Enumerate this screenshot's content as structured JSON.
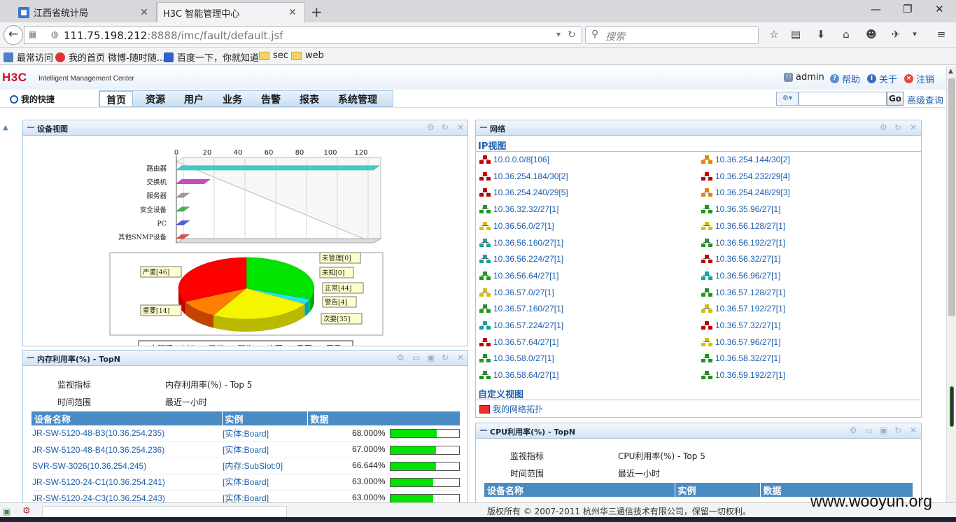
{
  "browser": {
    "tabs": [
      {
        "title": "江西省统计局",
        "close": "✕"
      },
      {
        "title": "H3C 智能管理中心",
        "close": "✕"
      }
    ],
    "new_tab": "+",
    "window_controls": {
      "minimize": "—",
      "maximize": "❐",
      "close": "✕"
    },
    "url_host": "111.75.198.212",
    "url_rest": ":8888/imc/fault/default.jsf",
    "search_placeholder": "搜索",
    "bookmarks": [
      "最常访问",
      "我的首页 微博-随时随...",
      "百度一下，你就知道",
      "sec",
      "web"
    ]
  },
  "imc": {
    "logo": "H3C",
    "logo_subtitle": "Intelligent Management Center",
    "user": "admin",
    "help": "帮助",
    "about": "关于",
    "logout": "注销",
    "quick_label": "我的快捷",
    "menus": [
      "首页",
      "资源",
      "用户",
      "业务",
      "告警",
      "报表",
      "系统管理"
    ],
    "selected_menu": "首页",
    "go_label": "Go",
    "advanced_query": "高级查询"
  },
  "device_view": {
    "title": "设备视图",
    "chart_data": [
      {
        "type": "bar",
        "orientation": "horizontal",
        "categories": [
          "路由器",
          "交换机",
          "服务器",
          "安全设备",
          "PC",
          "其他SNMP设备"
        ],
        "values": [
          128,
          18,
          0,
          0,
          0,
          0
        ],
        "xlim": [
          0,
          130
        ],
        "xticks": [
          "0",
          "20",
          "40",
          "60",
          "80",
          "100",
          "120"
        ],
        "colors": [
          "#46c8c4",
          "#c34fc0",
          "#9a9a9a",
          "#4caf50",
          "#5560d0",
          "#d05555"
        ]
      },
      {
        "type": "pie",
        "slices": [
          {
            "label": "未管理[0]",
            "name": "未管理",
            "value": 0,
            "color": "#808080"
          },
          {
            "label": "未知[0]",
            "name": "未知",
            "value": 0,
            "color": "#0000dd"
          },
          {
            "label": "正常[44]",
            "name": "正常",
            "value": 44,
            "color": "#00e400"
          },
          {
            "label": "警告[4]",
            "name": "警告",
            "value": 4,
            "color": "#22e6e6"
          },
          {
            "label": "次要[35]",
            "name": "次要",
            "value": 35,
            "color": "#f5f500"
          },
          {
            "label": "重要[14]",
            "name": "重要",
            "value": 14,
            "color": "#ff8000"
          },
          {
            "label": "严重[46]",
            "name": "严重",
            "value": 46,
            "color": "#ff0000"
          }
        ]
      }
    ]
  },
  "network": {
    "title": "网络",
    "ip_view": "IP视图",
    "custom_view": "自定义视图",
    "custom_item": "我的网络拓扑",
    "left": [
      {
        "label": "10.0.0.0/8[106]",
        "color": "#c00000"
      },
      {
        "label": "10.36.254.184/30[2]",
        "color": "#c00000"
      },
      {
        "label": "10.36.254.240/29[5]",
        "color": "#c00000"
      },
      {
        "label": "10.36.32.32/27[1]",
        "color": "#1a9a1a"
      },
      {
        "label": "10.36.56.0/27[1]",
        "color": "#d6c000"
      },
      {
        "label": "10.36.56.160/27[1]",
        "color": "#1aa0a0"
      },
      {
        "label": "10.36.56.224/27[1]",
        "color": "#1aa0a0"
      },
      {
        "label": "10.36.56.64/27[1]",
        "color": "#1a9a1a"
      },
      {
        "label": "10.36.57.0/27[1]",
        "color": "#d6c000"
      },
      {
        "label": "10.36.57.160/27[1]",
        "color": "#1a9a1a"
      },
      {
        "label": "10.36.57.224/27[1]",
        "color": "#1aa0a0"
      },
      {
        "label": "10.36.57.64/27[1]",
        "color": "#c00000"
      },
      {
        "label": "10.36.58.0/27[1]",
        "color": "#1a9a1a"
      },
      {
        "label": "10.36.58.64/27[1]",
        "color": "#1a9a1a"
      }
    ],
    "right": [
      {
        "label": "10.36.254.144/30[2]",
        "color": "#d98a00"
      },
      {
        "label": "10.36.254.232/29[4]",
        "color": "#c00000"
      },
      {
        "label": "10.36.254.248/29[3]",
        "color": "#d98a00"
      },
      {
        "label": "10.36.35.96/27[1]",
        "color": "#1a9a1a"
      },
      {
        "label": "10.36.56.128/27[1]",
        "color": "#d6c000"
      },
      {
        "label": "10.36.56.192/27[1]",
        "color": "#1a9a1a"
      },
      {
        "label": "10.36.56.32/27[1]",
        "color": "#c00000"
      },
      {
        "label": "10.36.56.96/27[1]",
        "color": "#1aa0a0"
      },
      {
        "label": "10.36.57.128/27[1]",
        "color": "#1a9a1a"
      },
      {
        "label": "10.36.57.192/27[1]",
        "color": "#d6c000"
      },
      {
        "label": "10.36.57.32/27[1]",
        "color": "#c00000"
      },
      {
        "label": "10.36.57.96/27[1]",
        "color": "#d6c000"
      },
      {
        "label": "10.36.58.32/27[1]",
        "color": "#1a9a1a"
      },
      {
        "label": "10.36.59.192/27[1]",
        "color": "#1a9a1a"
      }
    ]
  },
  "memory": {
    "title": "内存利用率(%) - TopN",
    "meta": [
      {
        "k": "监视指标",
        "v": "内存利用率(%) - Top 5"
      },
      {
        "k": "时间范围",
        "v": "最近一小时"
      }
    ],
    "headers": [
      "设备名称",
      "实例",
      "数据"
    ],
    "rows": [
      {
        "device": "JR-SW-5120-48-B3(10.36.254.235)",
        "instance": "[实体:Board]",
        "value": "68.000%",
        "pct": 68
      },
      {
        "device": "JR-SW-5120-48-B4(10.36.254.236)",
        "instance": "[实体:Board]",
        "value": "67.000%",
        "pct": 67
      },
      {
        "device": "SVR-SW-3026(10.36.254.245)",
        "instance": "[内存:SubSlot:0]",
        "value": "66.644%",
        "pct": 66.644
      },
      {
        "device": "JR-SW-5120-24-C1(10.36.254.241)",
        "instance": "[实体:Board]",
        "value": "63.000%",
        "pct": 63
      },
      {
        "device": "JR-SW-5120-24-C3(10.36.254.243)",
        "instance": "[实体:Board]",
        "value": "63.000%",
        "pct": 63
      }
    ]
  },
  "cpu": {
    "title": "CPU利用率(%) - TopN",
    "meta": [
      {
        "k": "监视指标",
        "v": "CPU利用率(%) - Top 5"
      },
      {
        "k": "时间范围",
        "v": "最近一小时"
      }
    ],
    "headers": [
      "设备名称",
      "实例",
      "数据"
    ]
  },
  "footer": {
    "copyright": "版权所有 © 2007-2011 杭州华三通信技术有限公司，保留一切权利。",
    "watermark": "www.wooyun.org"
  }
}
